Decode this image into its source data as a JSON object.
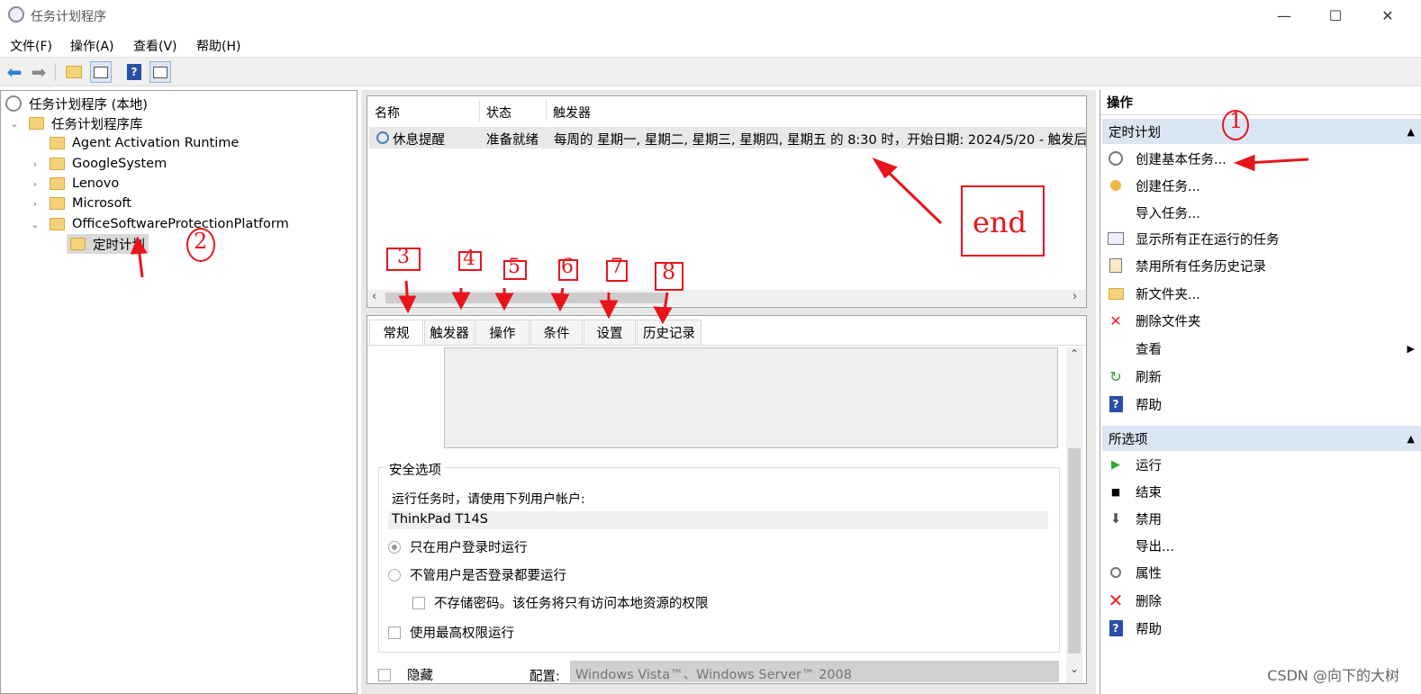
{
  "window": {
    "title": "任务计划程序",
    "minimize": "—",
    "maximize": "☐",
    "close": "✕"
  },
  "menu": [
    "文件(F)",
    "操作(A)",
    "查看(V)",
    "帮助(H)"
  ],
  "tree": {
    "root": "任务计划程序 (本地)",
    "library": "任务计划程序库",
    "folders": [
      "Agent Activation Runtime",
      "GoogleSystem",
      "Lenovo",
      "Microsoft",
      "OfficeSoftwareProtectionPlatform"
    ],
    "selected": "定时计划"
  },
  "task_list": {
    "columns": [
      "名称",
      "状态",
      "触发器"
    ],
    "rows": [
      {
        "name": "休息提醒",
        "status": "准备就绪",
        "trigger": "每周的 星期一, 星期二, 星期三, 星期四, 星期五 的 8:30 时，开始日期: 2024/5/20 - 触发后,"
      }
    ]
  },
  "tabs": [
    "常规",
    "触发器",
    "操作",
    "条件",
    "设置",
    "历史记录"
  ],
  "general": {
    "security_title": "安全选项",
    "run_as_label": "运行任务时，请使用下列用户帐户:",
    "user_account": "ThinkPad T14S",
    "option_logged_on": "只在用户登录时运行",
    "option_whether_logged": "不管用户是否登录都要运行",
    "option_no_password": "不存储密码。该任务将只有访问本地资源的权限",
    "option_highest": "使用最高权限运行",
    "hidden_label": "隐藏",
    "config_label": "配置:",
    "config_value": "Windows Vista™、Windows Server™ 2008"
  },
  "actions": {
    "header": "操作",
    "section1": "定时计划",
    "items1": [
      "创建基本任务...",
      "创建任务...",
      "导入任务...",
      "显示所有正在运行的任务",
      "禁用所有任务历史记录",
      "新文件夹...",
      "删除文件夹",
      "查看",
      "刷新",
      "帮助"
    ],
    "section2": "所选项",
    "items2": [
      "运行",
      "结束",
      "禁用",
      "导出...",
      "属性",
      "删除",
      "帮助"
    ]
  },
  "annotations": {
    "n1": "1",
    "n2": "2",
    "n3": "3",
    "n4": "4",
    "n5": "5",
    "n6": "6",
    "n7": "7",
    "n8": "8",
    "end": "end"
  },
  "watermark": "CSDN @向下的大树",
  "colors": {
    "section_header": "#dbe6f4",
    "annotation": "#e8141c",
    "pane_bg": "#e8e8e8"
  }
}
